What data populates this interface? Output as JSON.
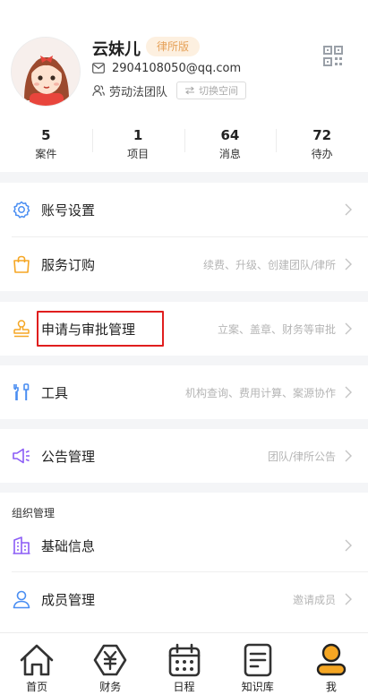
{
  "profile": {
    "name": "云妹儿",
    "badge": "律所版",
    "email": "2904108050@qq.com",
    "team": "劳动法团队",
    "switch_label": "切换空间"
  },
  "stats": [
    {
      "value": "5",
      "label": "案件"
    },
    {
      "value": "1",
      "label": "项目"
    },
    {
      "value": "64",
      "label": "消息"
    },
    {
      "value": "72",
      "label": "待办"
    }
  ],
  "menu": {
    "account": {
      "title": "账号设置",
      "hint": ""
    },
    "subscription": {
      "title": "服务订购",
      "hint": "续费、升级、创建团队/律所"
    },
    "approval": {
      "title": "申请与审批管理",
      "hint": "立案、盖章、财务等审批"
    },
    "tools": {
      "title": "工具",
      "hint": "机构查询、费用计算、案源协作"
    },
    "announcement": {
      "title": "公告管理",
      "hint": "团队/律所公告"
    },
    "org_section": "组织管理",
    "basic_info": {
      "title": "基础信息",
      "hint": ""
    },
    "members": {
      "title": "成员管理",
      "hint": "邀请成员"
    }
  },
  "tabbar": [
    {
      "label": "首页",
      "icon": "home-icon"
    },
    {
      "label": "财务",
      "icon": "finance-icon"
    },
    {
      "label": "日程",
      "icon": "calendar-icon"
    },
    {
      "label": "知识库",
      "icon": "knowledge-icon"
    },
    {
      "label": "我",
      "icon": "profile-icon",
      "active": true
    }
  ],
  "colors": {
    "accent_orange": "#f5a623",
    "badge_bg": "#fdf0e0",
    "badge_text": "#e6a25a",
    "icon_blue": "#4a8ef2",
    "icon_purple": "#8b5cf6",
    "highlight_red": "#e01e1e"
  }
}
